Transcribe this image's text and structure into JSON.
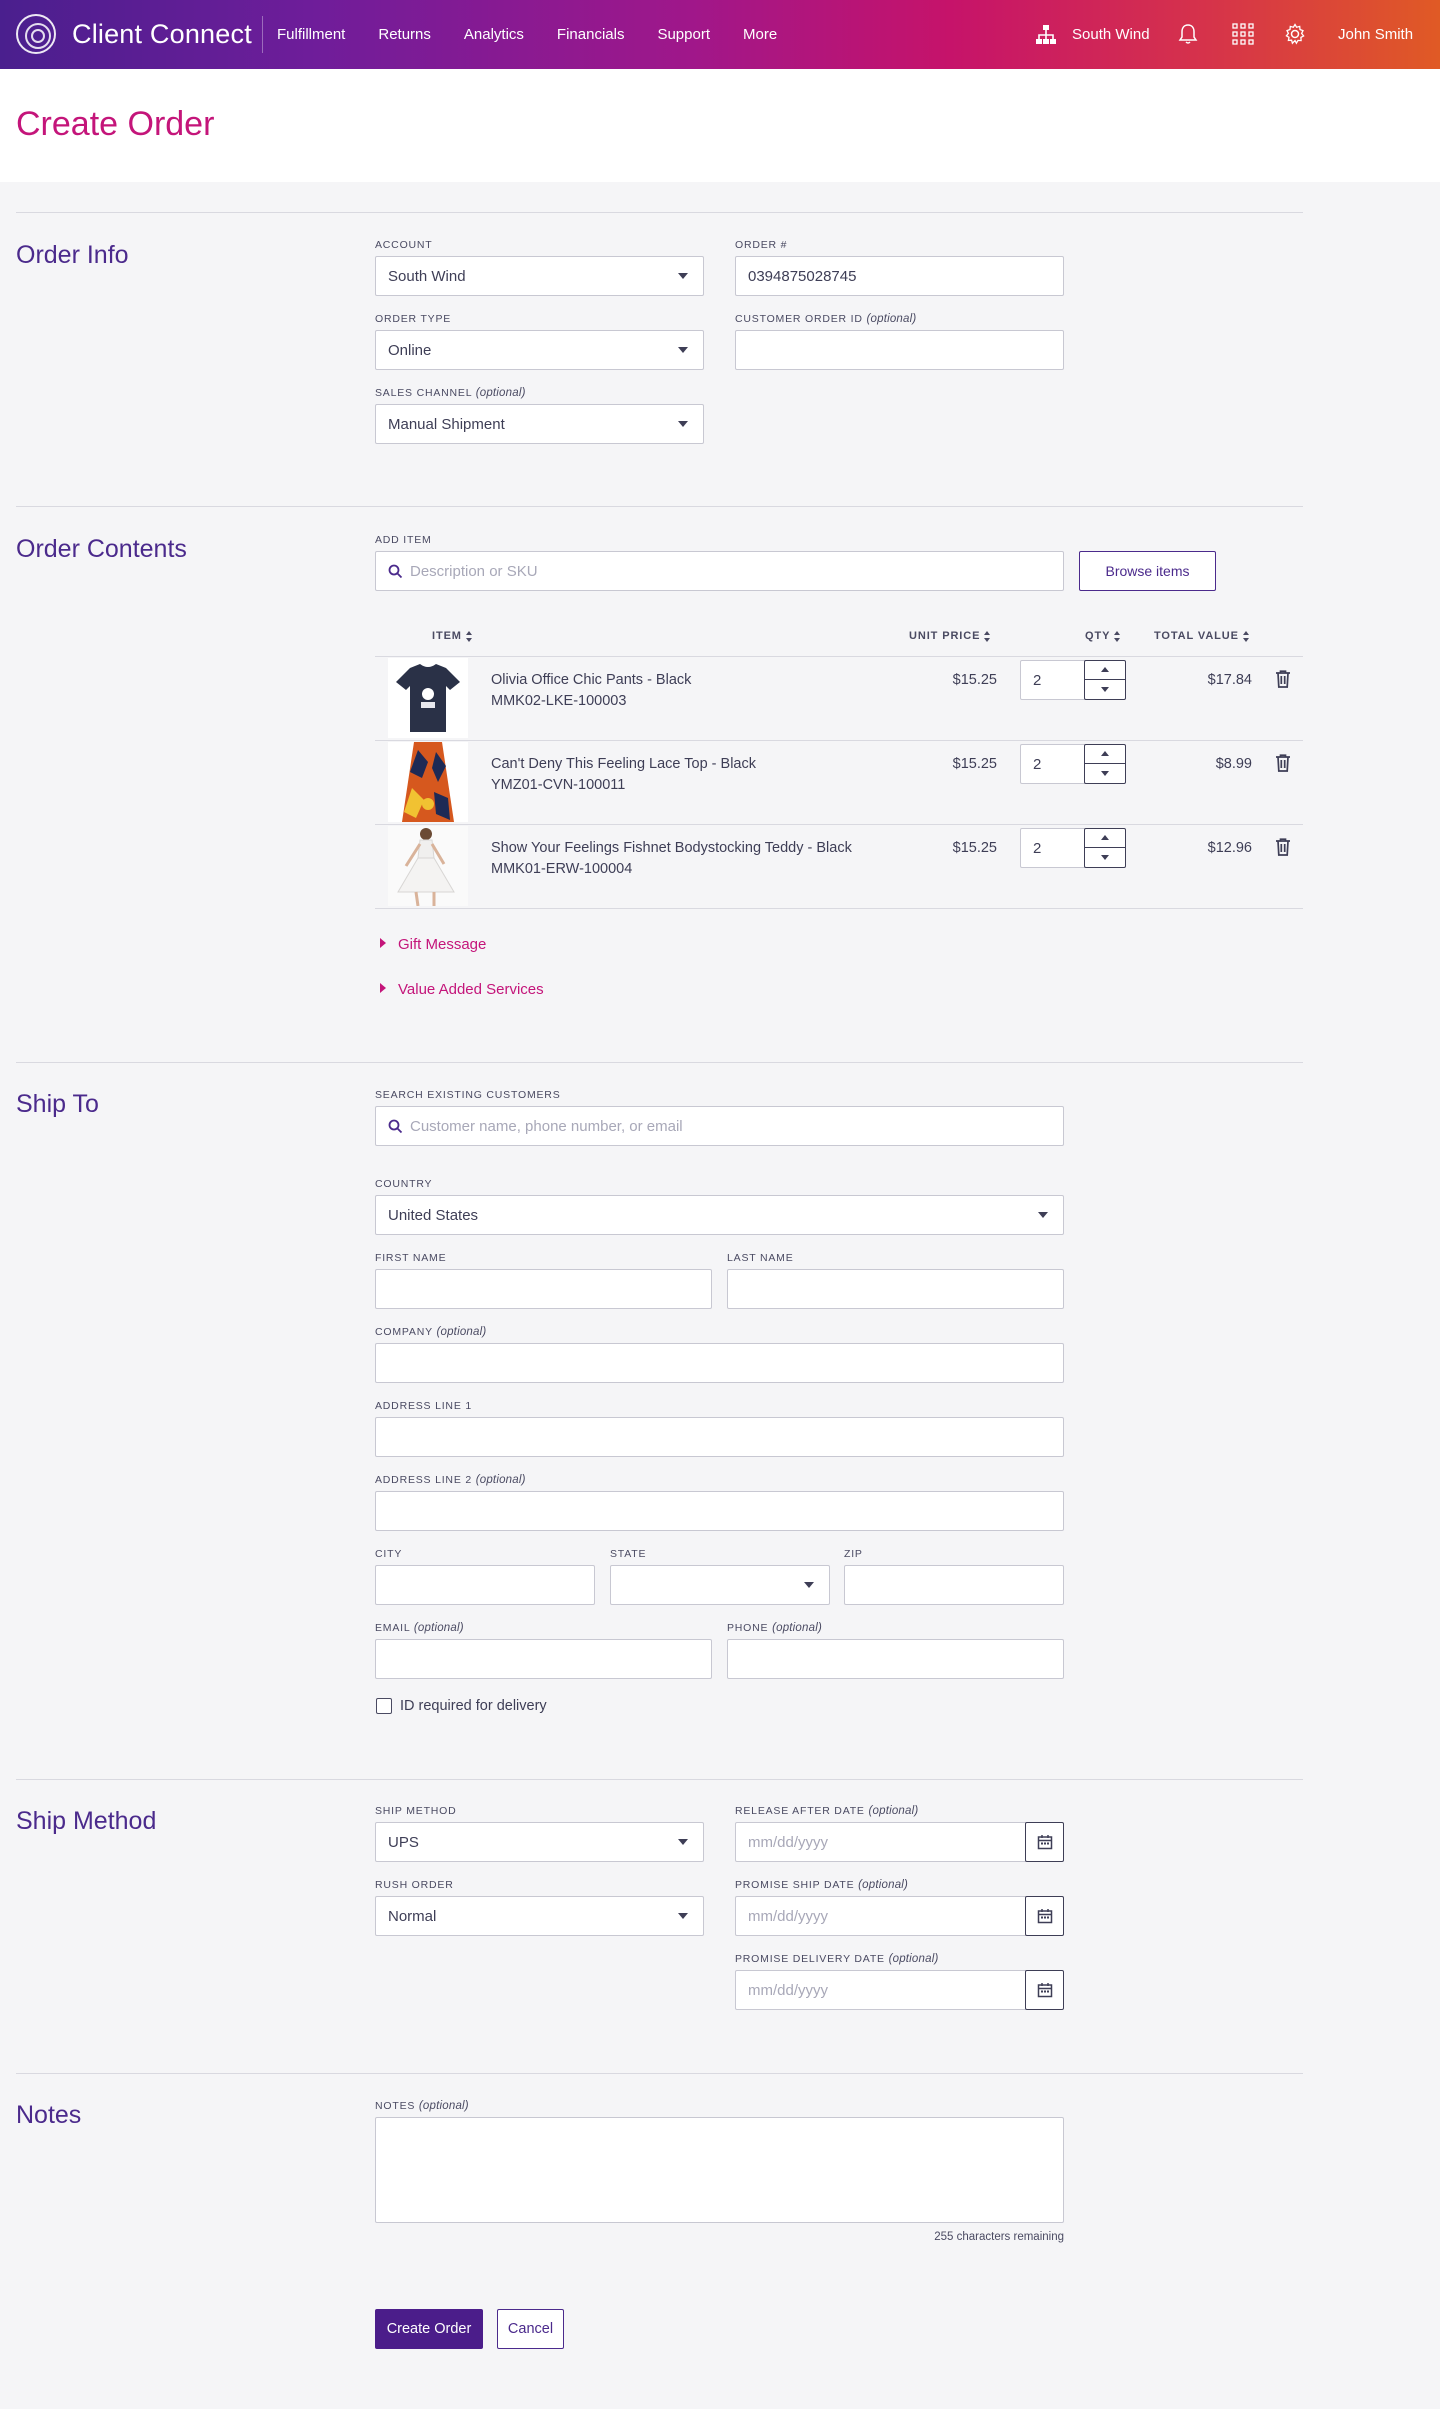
{
  "header": {
    "app_title": "Client Connect",
    "nav": [
      "Fulfillment",
      "Returns",
      "Analytics",
      "Financials",
      "Support",
      "More"
    ],
    "org_name": "South Wind",
    "user_name": "John Smith"
  },
  "page": {
    "title": "Create Order"
  },
  "order_info": {
    "title": "Order Info",
    "account_label": "ACCOUNT",
    "account_value": "South Wind",
    "order_number_label": "ORDER #",
    "order_number_value": "0394875028745",
    "order_type_label": "ORDER TYPE",
    "order_type_value": "Online",
    "customer_order_id_label": "CUSTOMER ORDER ID",
    "optional": "(optional)",
    "sales_channel_label": "SALES CHANNEL",
    "sales_channel_value": "Manual Shipment"
  },
  "order_contents": {
    "title": "Order Contents",
    "add_item_label": "ADD ITEM",
    "add_item_placeholder": "Description or SKU",
    "browse_button": "Browse items",
    "columns": {
      "item": "ITEM",
      "unit_price": "UNIT PRICE",
      "qty": "QTY",
      "total_value": "TOTAL VALUE"
    },
    "items": [
      {
        "name": "Olivia Office Chic Pants - Black",
        "sku": "MMK02-LKE-100003",
        "unit_price": "$15.25",
        "qty": "2",
        "total": "$17.84"
      },
      {
        "name": "Can't Deny This Feeling Lace Top - Black",
        "sku": "YMZ01-CVN-100011",
        "unit_price": "$15.25",
        "qty": "2",
        "total": "$8.99"
      },
      {
        "name": "Show Your Feelings Fishnet Bodystocking Teddy - Black",
        "sku": "MMK01-ERW-100004",
        "unit_price": "$15.25",
        "qty": "2",
        "total": "$12.96"
      }
    ],
    "gift_message": "Gift Message",
    "value_added_services": "Value Added Services"
  },
  "ship_to": {
    "title": "Ship To",
    "search_label": "SEARCH EXISTING CUSTOMERS",
    "search_placeholder": "Customer name, phone number, or email",
    "country_label": "COUNTRY",
    "country_value": "United States",
    "first_name_label": "FIRST NAME",
    "last_name_label": "LAST NAME",
    "company_label": "COMPANY",
    "address1_label": "ADDRESS LINE 1",
    "address2_label": "ADDRESS LINE 2",
    "city_label": "CITY",
    "state_label": "STATE",
    "zip_label": "ZIP",
    "email_label": "EMAIL",
    "phone_label": "PHONE",
    "id_required_label": "ID required for delivery"
  },
  "ship_method": {
    "title": "Ship Method",
    "ship_method_label": "SHIP METHOD",
    "ship_method_value": "UPS",
    "rush_order_label": "RUSH ORDER",
    "rush_order_value": "Normal",
    "release_after_label": "RELEASE AFTER DATE",
    "promise_ship_label": "PROMISE SHIP DATE",
    "promise_delivery_label": "PROMISE DELIVERY DATE",
    "date_placeholder": "mm/dd/yyyy"
  },
  "notes": {
    "title": "Notes",
    "label": "NOTES",
    "remaining": "255 characters remaining"
  },
  "actions": {
    "create": "Create Order",
    "cancel": "Cancel"
  },
  "colors": {
    "accent": "#c4157a",
    "primary": "#4b1d8a"
  }
}
